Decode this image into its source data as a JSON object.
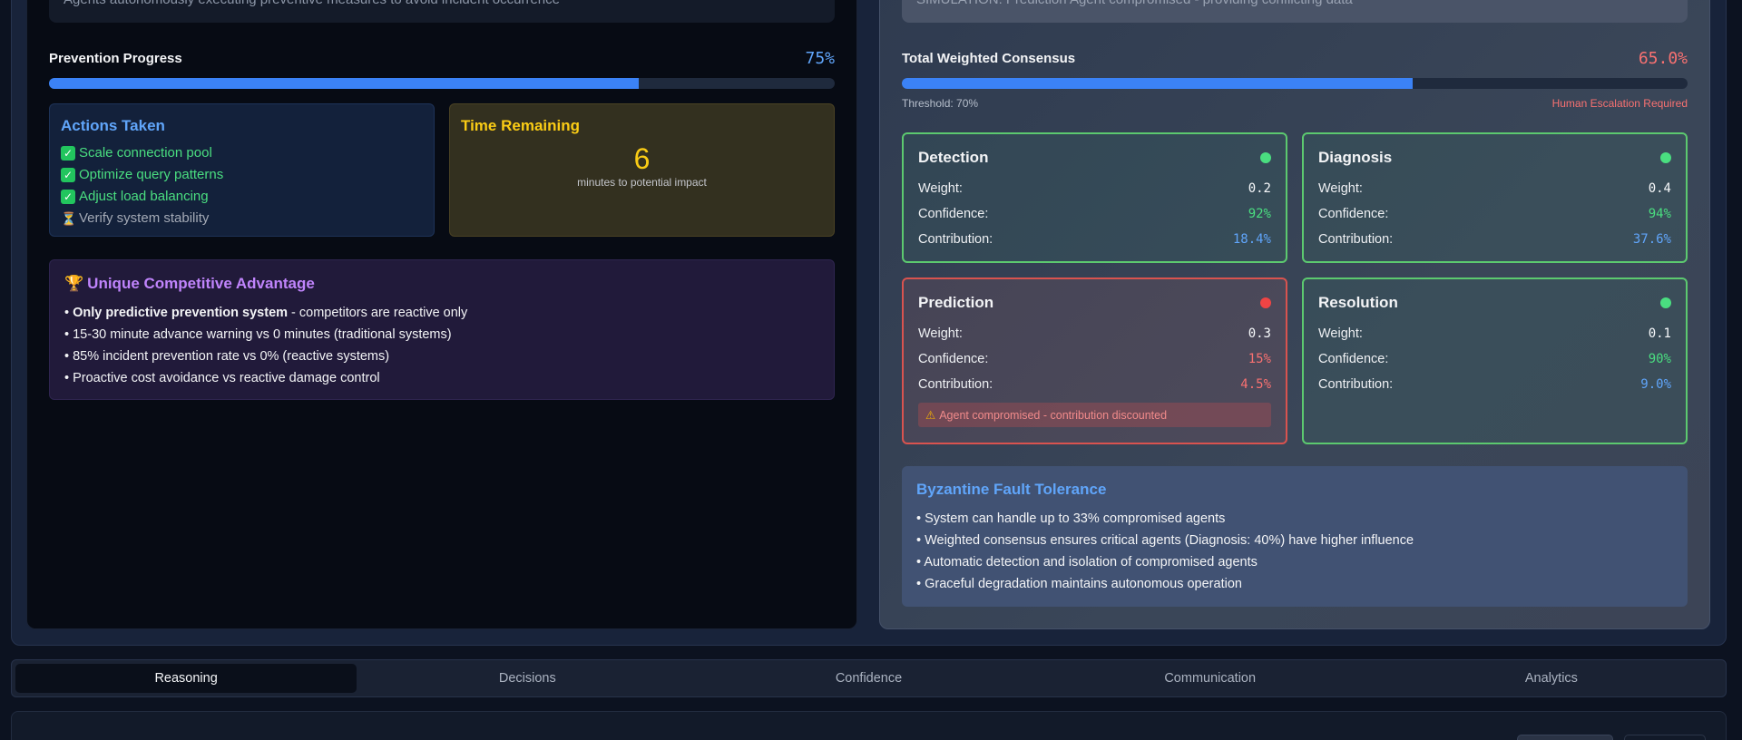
{
  "left": {
    "banner_text": "Agents autonomously executing preventive measures to avoid incident occurrence",
    "progress": {
      "label": "Prevention Progress",
      "value_text": "75%",
      "value": 75
    },
    "actions": {
      "title": "Actions Taken",
      "items": [
        {
          "text": "Scale connection pool",
          "done": true
        },
        {
          "text": "Optimize query patterns",
          "done": true
        },
        {
          "text": "Adjust load balancing",
          "done": true
        },
        {
          "text": "Verify system stability",
          "done": false
        }
      ]
    },
    "time": {
      "title": "Time Remaining",
      "value": "6",
      "sub": "minutes to potential impact"
    },
    "advantage": {
      "title": "Unique Competitive Advantage",
      "item1_bold": "Only predictive prevention system",
      "item1_rest": " - competitors are reactive only",
      "items": [
        "15-30 minute advance warning vs 0 minutes (traditional systems)",
        "85% incident prevention rate vs 0% (reactive systems)",
        "Proactive cost avoidance vs reactive damage control"
      ]
    }
  },
  "right": {
    "banner_text": "SIMULATION: Prediction Agent compromised - providing conflicting data",
    "consensus": {
      "label": "Total Weighted Consensus",
      "value_text": "65.0%",
      "value": 65,
      "threshold": "Threshold: 70%",
      "escalation": "Human Escalation Required"
    },
    "agents": [
      {
        "name": "Detection",
        "status": "ok",
        "weight": "0.2",
        "confidence": "92%",
        "contribution": "18.4%"
      },
      {
        "name": "Diagnosis",
        "status": "ok",
        "weight": "0.4",
        "confidence": "94%",
        "contribution": "37.6%"
      },
      {
        "name": "Prediction",
        "status": "compromised",
        "weight": "0.3",
        "confidence": "15%",
        "contribution": "4.5%",
        "warning": "Agent compromised - contribution discounted"
      },
      {
        "name": "Resolution",
        "status": "ok",
        "weight": "0.1",
        "confidence": "90%",
        "contribution": "9.0%"
      }
    ],
    "labels": {
      "weight": "Weight:",
      "confidence": "Confidence:",
      "contribution": "Contribution:"
    },
    "byzantine": {
      "title": "Byzantine Fault Tolerance",
      "items": [
        "System can handle up to 33% compromised agents",
        "Weighted consensus ensures critical agents (Diagnosis: 40%) have higher influence",
        "Automatic detection and isolation of compromised agents",
        "Graceful degradation maintains autonomous operation"
      ]
    }
  },
  "tabs": [
    {
      "label": "Reasoning",
      "active": true
    },
    {
      "label": "Decisions",
      "active": false
    },
    {
      "label": "Confidence",
      "active": false
    },
    {
      "label": "Communication",
      "active": false
    },
    {
      "label": "Analytics",
      "active": false
    }
  ],
  "colors": {
    "accent_blue": "#3b82f6",
    "ok_green": "#4ade80",
    "alert_red": "#f87171",
    "time_yellow": "#facc15",
    "advantage_purple": "#c084fc"
  }
}
